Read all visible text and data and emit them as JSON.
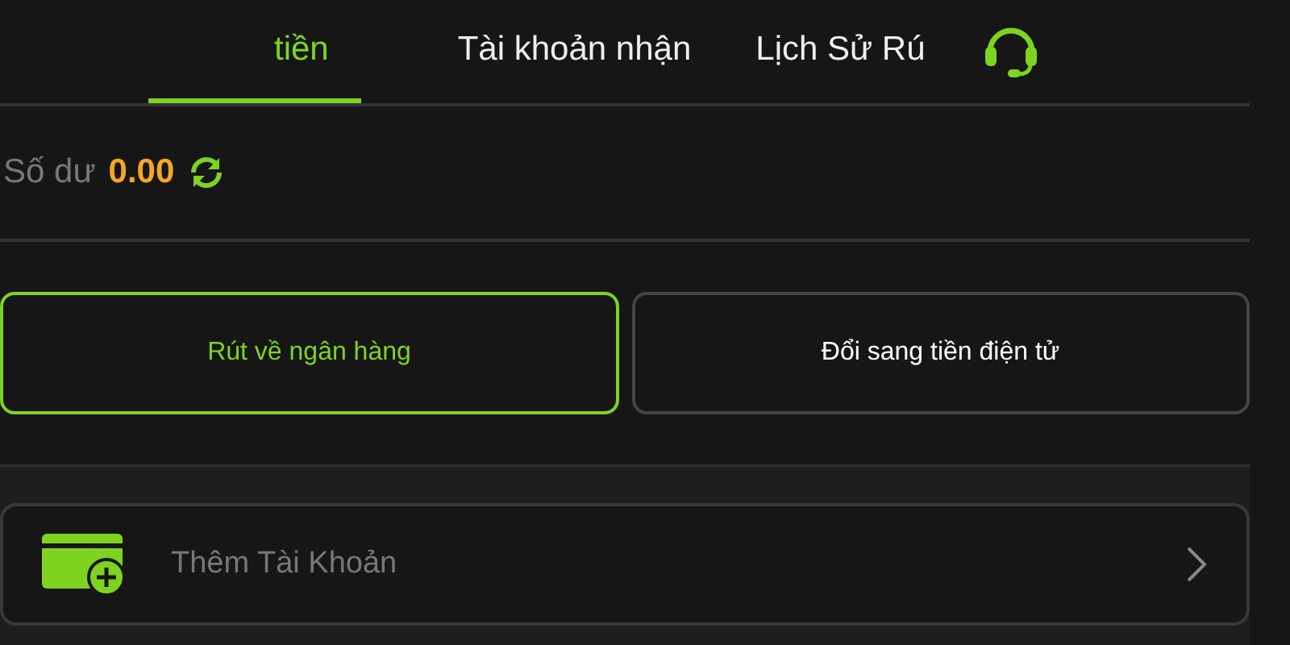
{
  "tabs": [
    {
      "label": "tiền",
      "selected": true
    },
    {
      "label": "Tài khoản nhận",
      "selected": false
    },
    {
      "label": "Lịch Sử Rú",
      "selected": false
    }
  ],
  "balance": {
    "label": "Số dư",
    "amount": "0.00"
  },
  "methods": [
    {
      "label": "Rút về ngân hàng",
      "selected": true
    },
    {
      "label": "Đổi sang tiền điện tử",
      "selected": false
    }
  ],
  "add_account": {
    "label": "Thêm Tài Khoản"
  }
}
